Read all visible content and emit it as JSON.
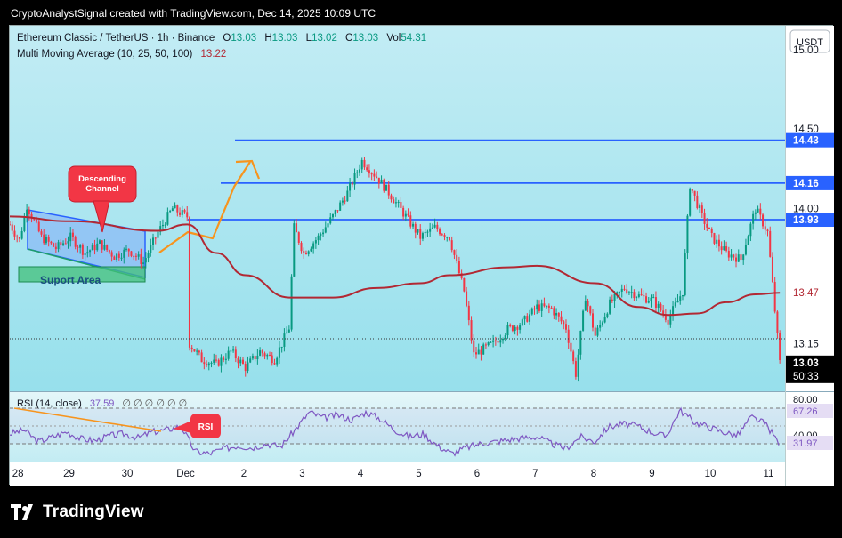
{
  "header": {
    "credit": "CryptoAnalystSignal created with TradingView.com, Dec 14, 2025 10:09 UTC"
  },
  "legend": {
    "symbol": "Ethereum Classic / TetherUS · 1h · Binance",
    "o_label": "O",
    "o_value": "13.03",
    "h_label": "H",
    "h_value": "13.03",
    "l_label": "L",
    "l_value": "13.02",
    "c_label": "C",
    "c_value": "13.03",
    "vol_label": "Vol",
    "vol_value": "54.31",
    "ma_label": "Multi Moving Average (10, 25, 50, 100)",
    "ma_value": "13.22"
  },
  "currency_button": "USDT",
  "price_axis": {
    "ticks": [
      "15.00",
      "14.50",
      "14.00",
      "13.15"
    ],
    "level_badges": [
      "14.43",
      "14.16",
      "13.93"
    ],
    "ma_badge": "13.47",
    "current_price": "13.03",
    "countdown": "50:33"
  },
  "annotations": {
    "descending_channel": "Descending Channel",
    "support_area": "Suport Area",
    "rsi_callout": "RSI"
  },
  "rsi": {
    "legend": "RSI (14, close)",
    "value": "37.59",
    "placeholders": "∅ ∅ ∅ ∅ ∅ ∅",
    "ticks": [
      "80.00",
      "40.00"
    ],
    "badges": [
      "67.26",
      "31.97"
    ]
  },
  "time_axis": [
    "28",
    "29",
    "30",
    "Dec",
    "2",
    "3",
    "4",
    "5",
    "6",
    "7",
    "8",
    "9",
    "10",
    "11"
  ],
  "footer": {
    "brand": "TradingView"
  },
  "colors": {
    "up": "#089981",
    "down": "#f23645",
    "ma": "#b22833",
    "level": "#2962ff",
    "arrow": "#f7941d",
    "rsi": "#7e57c2",
    "callout": "#f23645"
  },
  "chart_data": {
    "type": "candlestick",
    "symbol": "ETCUSDT",
    "interval": "1h",
    "ylim": [
      12.85,
      15.15
    ],
    "horizontal_levels": [
      14.43,
      14.16,
      13.93
    ],
    "close_path": [
      [
        "Nov 27 23:00",
        13.9
      ],
      [
        "Nov 28 03:00",
        13.8
      ],
      [
        "Nov 28 06:00",
        14.02
      ],
      [
        "Nov 28 12:00",
        13.82
      ],
      [
        "Nov 28 18:00",
        13.75
      ],
      [
        "Nov 29 00:00",
        13.82
      ],
      [
        "Nov 29 06:00",
        13.72
      ],
      [
        "Nov 29 12:00",
        13.78
      ],
      [
        "Nov 29 18:00",
        13.7
      ],
      [
        "Nov 30 00:00",
        13.74
      ],
      [
        "Nov 30 06:00",
        13.66
      ],
      [
        "Nov 30 12:00",
        13.85
      ],
      [
        "Nov 30 18:00",
        14.0
      ],
      [
        "Dec 1 00:00",
        13.95
      ],
      [
        "Dec 1 01:00",
        13.15
      ],
      [
        "Dec 1 06:00",
        13.05
      ],
      [
        "Dec 1 12:00",
        13.02
      ],
      [
        "Dec 1 18:00",
        13.1
      ],
      [
        "Dec 2 00:00",
        13.0
      ],
      [
        "Dec 2 06:00",
        13.1
      ],
      [
        "Dec 2 12:00",
        13.05
      ],
      [
        "Dec 2 18:00",
        13.25
      ],
      [
        "Dec 2 20:00",
        13.88
      ],
      [
        "Dec 3 00:00",
        13.72
      ],
      [
        "Dec 3 06:00",
        13.82
      ],
      [
        "Dec 3 12:00",
        13.95
      ],
      [
        "Dec 3 18:00",
        14.1
      ],
      [
        "Dec 4 00:00",
        14.3
      ],
      [
        "Dec 4 06:00",
        14.2
      ],
      [
        "Dec 4 12:00",
        14.08
      ],
      [
        "Dec 4 18:00",
        13.95
      ],
      [
        "Dec 5 00:00",
        13.82
      ],
      [
        "Dec 5 06:00",
        13.88
      ],
      [
        "Dec 5 12:00",
        13.82
      ],
      [
        "Dec 5 18:00",
        13.48
      ],
      [
        "Dec 5 22:00",
        13.08
      ],
      [
        "Dec 6 06:00",
        13.15
      ],
      [
        "Dec 6 12:00",
        13.24
      ],
      [
        "Dec 6 18:00",
        13.28
      ],
      [
        "Dec 7 00:00",
        13.38
      ],
      [
        "Dec 7 06:00",
        13.37
      ],
      [
        "Dec 7 12:00",
        13.25
      ],
      [
        "Dec 7 16:00",
        12.96
      ],
      [
        "Dec 7 20:00",
        13.45
      ],
      [
        "Dec 8 00:00",
        13.2
      ],
      [
        "Dec 8 06:00",
        13.4
      ],
      [
        "Dec 8 12:00",
        13.5
      ],
      [
        "Dec 8 18:00",
        13.45
      ],
      [
        "Dec 9 00:00",
        13.42
      ],
      [
        "Dec 9 06:00",
        13.3
      ],
      [
        "Dec 9 12:00",
        13.48
      ],
      [
        "Dec 9 15:00",
        14.15
      ],
      [
        "Dec 9 20:00",
        13.95
      ],
      [
        "Dec 10 00:00",
        13.82
      ],
      [
        "Dec 10 06:00",
        13.72
      ],
      [
        "Dec 10 12:00",
        13.68
      ],
      [
        "Dec 10 18:00",
        14.0
      ],
      [
        "Dec 10 23:00",
        13.85
      ],
      [
        "Dec 11 04:00",
        13.03
      ]
    ],
    "moving_average": [
      [
        "Nov 27 23:00",
        13.95
      ],
      [
        "Nov 29 00:00",
        13.92
      ],
      [
        "Nov 30 12:00",
        13.86
      ],
      [
        "Dec 1 00:00",
        13.9
      ],
      [
        "Dec 1 12:00",
        13.72
      ],
      [
        "Dec 2 00:00",
        13.58
      ],
      [
        "Dec 2 18:00",
        13.44
      ],
      [
        "Dec 3 12:00",
        13.44
      ],
      [
        "Dec 4 06:00",
        13.5
      ],
      [
        "Dec 5 00:00",
        13.53
      ],
      [
        "Dec 5 12:00",
        13.58
      ],
      [
        "Dec 6 12:00",
        13.63
      ],
      [
        "Dec 7 00:00",
        13.64
      ],
      [
        "Dec 8 00:00",
        13.53
      ],
      [
        "Dec 8 18:00",
        13.38
      ],
      [
        "Dec 9 06:00",
        13.33
      ],
      [
        "Dec 9 18:00",
        13.34
      ],
      [
        "Dec 10 06:00",
        13.41
      ],
      [
        "Dec 10 18:00",
        13.46
      ],
      [
        "Dec 11 04:00",
        13.47
      ]
    ],
    "rsi": {
      "ylim": [
        20,
        90
      ],
      "overbought": 80,
      "oversold": 30,
      "values": [
        48,
        52,
        40,
        45,
        50,
        43,
        41,
        46,
        48,
        44,
        50,
        52,
        56,
        30,
        28,
        33,
        36,
        34,
        38,
        35,
        52,
        70,
        64,
        67,
        62,
        70,
        63,
        52,
        45,
        48,
        36,
        28,
        34,
        38,
        40,
        42,
        44,
        45,
        38,
        33,
        45,
        40,
        55,
        58,
        56,
        50,
        45,
        72,
        60,
        55,
        50,
        46,
        65,
        58,
        37.59
      ]
    }
  }
}
